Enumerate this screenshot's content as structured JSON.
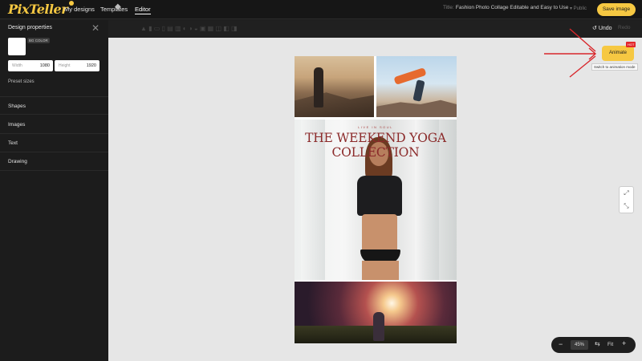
{
  "topbar": {
    "logo": "PixTeller",
    "nav": [
      "My designs",
      "Templates",
      "Editor"
    ],
    "title_label": "Title:",
    "title_value": "Fashion Photo Collage Editable and Easy to Use",
    "visibility": "▾ Public",
    "save_label": "Save image"
  },
  "sidebar": {
    "title": "Design properties",
    "bg_color_label": "BG COLOR",
    "width_label": "Width",
    "width_value": "1080",
    "height_label": "Height",
    "height_value": "1920",
    "preset_sizes": "Preset sizes",
    "sections": [
      "Shapes",
      "Images",
      "Text",
      "Drawing"
    ]
  },
  "toolbar": {
    "undo_label": "Undo",
    "redo_label": "Redo"
  },
  "canvas": {
    "small_text": "LIVE IN SOUL",
    "headline": "THE WEEKEND YOGA COLLECTION"
  },
  "animate": {
    "label": "Animate",
    "badge": "HOT",
    "tooltip": "Switch to animation mode"
  },
  "zoom": {
    "value": "45%",
    "fit_label": "Fit"
  },
  "colors": {
    "accent": "#f6c842",
    "headline": "#8b2a2a",
    "arrow": "#d8262b"
  },
  "icons": [
    "close-icon",
    "layer-icon",
    "undo-icon",
    "fit-icon",
    "expand-icon",
    "contract-icon"
  ]
}
